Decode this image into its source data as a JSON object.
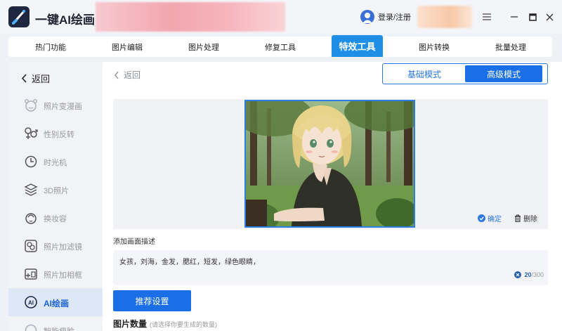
{
  "app": {
    "title": "一键AI绘画",
    "login": "登录/注册"
  },
  "tabs": [
    {
      "label": "热门功能"
    },
    {
      "label": "图片编辑"
    },
    {
      "label": "图片处理"
    },
    {
      "label": "修复工具"
    },
    {
      "label": "特效工具",
      "active": true
    },
    {
      "label": "图片转换"
    },
    {
      "label": "批量处理"
    }
  ],
  "sidebar": {
    "back": "返回",
    "items": [
      {
        "label": "照片变漫画",
        "icon": "cartoon-face-icon"
      },
      {
        "label": "性别反转",
        "icon": "gender-icon"
      },
      {
        "label": "时光机",
        "icon": "clock-icon"
      },
      {
        "label": "3D照片",
        "icon": "layers-icon"
      },
      {
        "label": "换妆容",
        "icon": "makeup-icon"
      },
      {
        "label": "照片加滤镜",
        "icon": "filter-icon"
      },
      {
        "label": "照片加相框",
        "icon": "frame-icon"
      },
      {
        "label": "AI绘画",
        "icon": "ai-icon",
        "active": true
      },
      {
        "label": "智能瘦脸",
        "icon": "face-slim-icon"
      }
    ]
  },
  "main": {
    "back": "返回",
    "modes": {
      "basic": "基础模式",
      "advanced": "高级模式",
      "selected": "高级模式"
    },
    "confirm": "确定",
    "delete": "删除",
    "desc_label": "添加画面描述",
    "desc_text": "女孩，刘海，金发，腮红，短发，绿色眼睛，",
    "char_count": "20",
    "char_max": "/300",
    "recommend": "推荐设置",
    "count_label": "图片数量",
    "count_hint": "(请选择你要生成的数量)"
  },
  "colors": {
    "accent": "#1a6fe6",
    "tab_active": "#1f8ee6",
    "sidebar_active_bg": "#dde7f6"
  }
}
